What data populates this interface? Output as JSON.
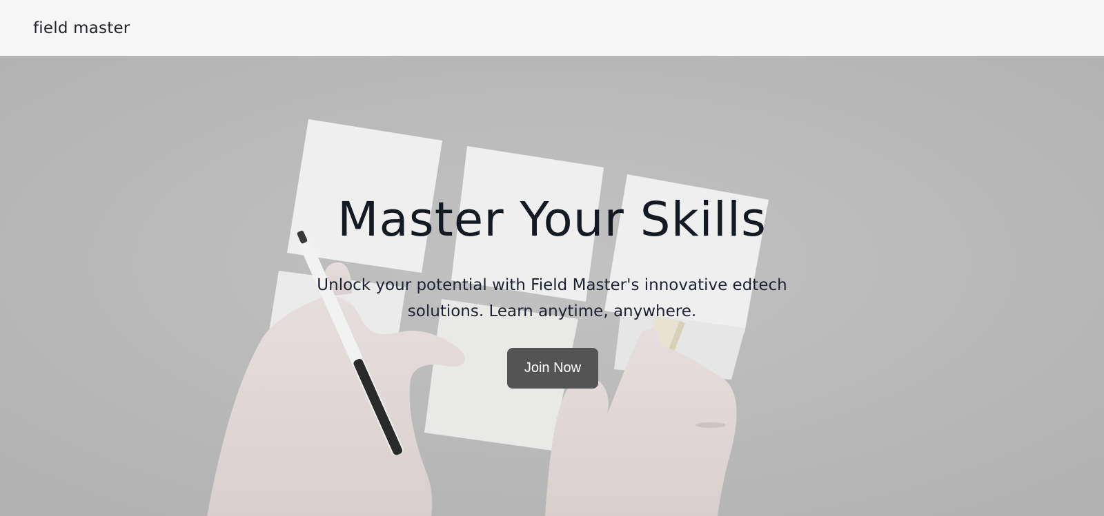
{
  "header": {
    "brand": "field master"
  },
  "hero": {
    "title": "Master Your Skills",
    "subtitle": "Unlock your potential with Field Master's innovative edtech solutions. Learn anytime, anywhere.",
    "cta_label": "Join Now",
    "background_image": "hands-with-sticky-notes-and-marker"
  },
  "colors": {
    "navbar_bg": "#f6f6f6",
    "hero_overlay": "#b9b9b9",
    "title_text": "#141a24",
    "button_bg": "#545454",
    "button_text": "#ffffff"
  }
}
